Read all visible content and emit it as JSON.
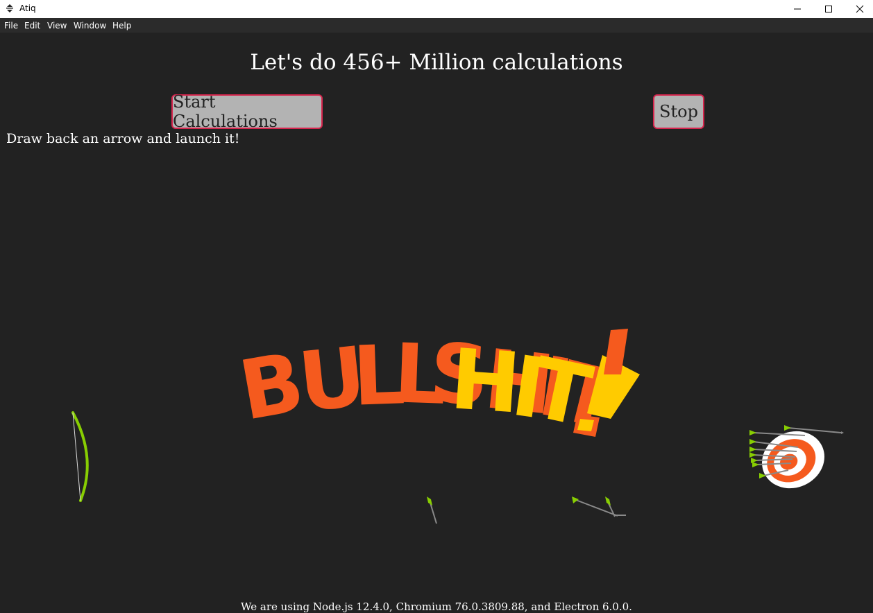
{
  "window": {
    "title": "Atiq"
  },
  "menu": {
    "items": [
      "File",
      "Edit",
      "View",
      "Window",
      "Help"
    ]
  },
  "main": {
    "heading": "Let's do 456+ Million calculations",
    "start_button_label": "Start Calculations",
    "stop_button_label": "Stop",
    "instructions": "Draw back an arrow and launch it!",
    "feedback_text": "BULLSHIT!",
    "footer": "We are using Node.js 12.4.0, Chromium 76.0.3809.88, and Electron 6.0.0."
  },
  "game": {
    "colors": {
      "background": "#222222",
      "bow": "#88ce02",
      "arrow_shaft": "#8a8a8a",
      "target_red": "#f55a1e",
      "target_white": "#ffffff",
      "feedback_orange": "#f55a1e",
      "feedback_yellow": "#ffcb00",
      "button_border": "#d6254d"
    }
  }
}
